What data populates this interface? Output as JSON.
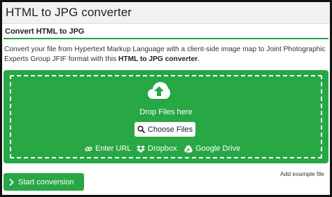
{
  "header": {
    "title": "HTML to JPG converter"
  },
  "section": {
    "title": "Convert HTML to JPG",
    "description_text": "Convert your file from Hypertext Markup Language with a client-side image map to Joint Photographic Experts Group JFIF format with this ",
    "description_strong": "HTML to JPG converter",
    "description_end": "."
  },
  "dropzone": {
    "icon": "cloud-upload-icon",
    "drop_label": "Drop Files here",
    "choose_label": "Choose Files",
    "sources": [
      {
        "label": "Enter URL",
        "icon": "link-icon"
      },
      {
        "label": "Dropbox",
        "icon": "dropbox-icon"
      },
      {
        "label": "Google Drive",
        "icon": "google-drive-icon"
      }
    ]
  },
  "actions": {
    "start_label": "Start conversion",
    "add_example_label": "Add example file"
  },
  "colors": {
    "accent": "#28a745",
    "header_bg": "#f1f1f1",
    "border": "#111111"
  }
}
